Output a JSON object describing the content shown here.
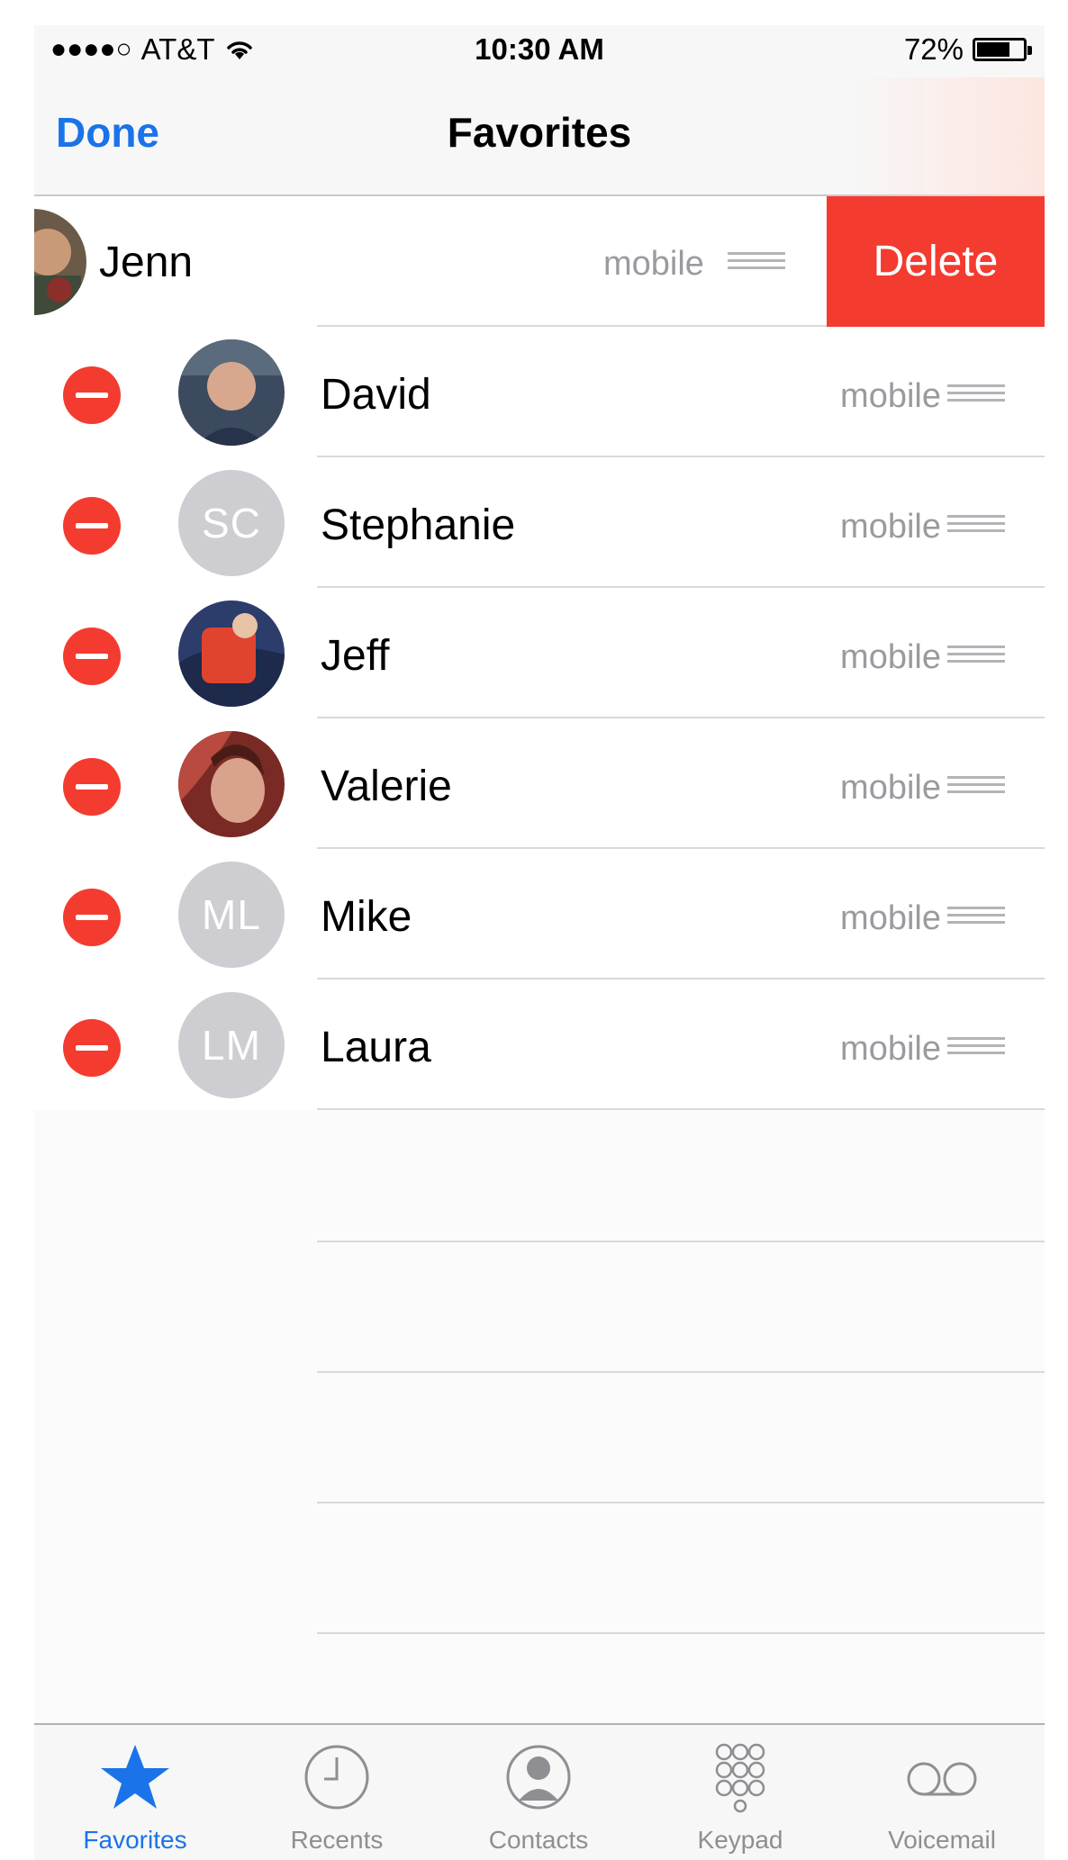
{
  "status_bar": {
    "signal": "●●●●○",
    "carrier": "AT&T",
    "wifi_icon": "wifi-icon",
    "time": "10:30 AM",
    "battery_percent": "72%",
    "battery_level": 0.72
  },
  "nav": {
    "done_label": "Done",
    "title": "Favorites"
  },
  "swiped_row": {
    "name": "Jenn",
    "type": "mobile",
    "delete_label": "Delete"
  },
  "favorites": [
    {
      "name": "David",
      "type": "mobile",
      "avatar": "photo",
      "initials": ""
    },
    {
      "name": "Stephanie",
      "type": "mobile",
      "avatar": "initials",
      "initials": "SC"
    },
    {
      "name": "Jeff",
      "type": "mobile",
      "avatar": "photo",
      "initials": ""
    },
    {
      "name": "Valerie",
      "type": "mobile",
      "avatar": "photo",
      "initials": ""
    },
    {
      "name": "Mike",
      "type": "mobile",
      "avatar": "initials",
      "initials": "ML"
    },
    {
      "name": "Laura",
      "type": "mobile",
      "avatar": "initials",
      "initials": "LM"
    }
  ],
  "tabs": [
    {
      "label": "Favorites",
      "icon": "star-icon",
      "active": true
    },
    {
      "label": "Recents",
      "icon": "clock-icon",
      "active": false
    },
    {
      "label": "Contacts",
      "icon": "person-icon",
      "active": false
    },
    {
      "label": "Keypad",
      "icon": "keypad-icon",
      "active": false
    },
    {
      "label": "Voicemail",
      "icon": "voicemail-icon",
      "active": false
    }
  ],
  "colors": {
    "accent": "#1a73e8",
    "destructive": "#f43b2f",
    "secondary_text": "#9a9a9f"
  }
}
